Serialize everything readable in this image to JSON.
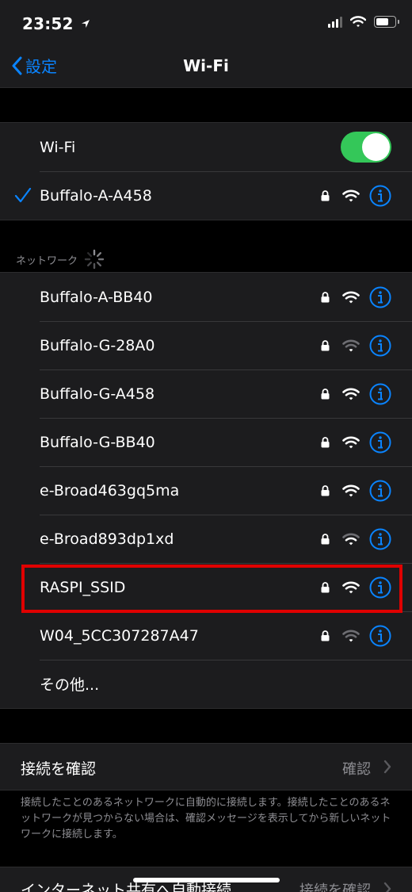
{
  "status_bar": {
    "time": "23:52"
  },
  "nav": {
    "back_label": "設定",
    "title": "Wi-Fi"
  },
  "wifi_section": {
    "toggle_label": "Wi-Fi",
    "toggle_on": true,
    "connected_network": "Buffalo-A-A458"
  },
  "networks_header": "ネットワーク",
  "networks": [
    {
      "name": "Buffalo-A-BB40",
      "locked": true,
      "signal_bars": 3
    },
    {
      "name": "Buffalo-G-28A0",
      "locked": true,
      "signal_bars": 1
    },
    {
      "name": "Buffalo-G-A458",
      "locked": true,
      "signal_bars": 3
    },
    {
      "name": "Buffalo-G-BB40",
      "locked": true,
      "signal_bars": 3
    },
    {
      "name": "e-Broad463gq5ma",
      "locked": true,
      "signal_bars": 3
    },
    {
      "name": "e-Broad893dp1xd",
      "locked": true,
      "signal_bars": 2
    },
    {
      "name": "RASPI_SSID",
      "locked": true,
      "signal_bars": 3
    },
    {
      "name": "W04_5CC307287A47",
      "locked": true,
      "signal_bars": 1
    }
  ],
  "other_label": "その他...",
  "ask_to_join": {
    "label": "接続を確認",
    "value": "確認"
  },
  "footer_text": "接続したことのあるネットワークに自動的に接続します。接続したことのあるネットワークが見つからない場合は、確認メッセージを表示してから新しいネットワークに接続します。",
  "hotspot": {
    "label": "インターネット共有へ自動接続",
    "value": "接続を確認"
  },
  "colors": {
    "accent": "#0a84ff",
    "toggle_on": "#34c759",
    "highlight": "#e00000"
  }
}
